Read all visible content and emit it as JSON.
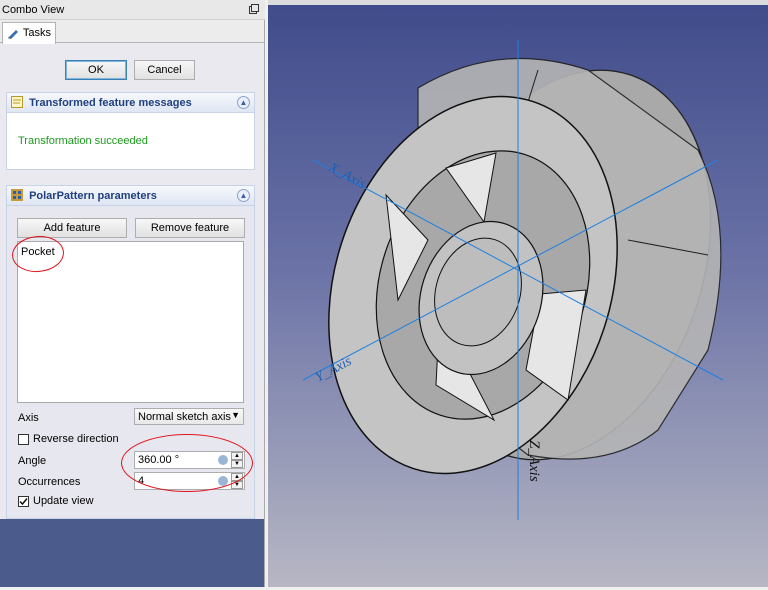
{
  "combo_view": {
    "title": "Combo View",
    "tab_label": "Tasks"
  },
  "dialog": {
    "ok_label": "OK",
    "cancel_label": "Cancel"
  },
  "messages_box": {
    "title": "Transformed feature messages",
    "text": "Transformation succeeded"
  },
  "polar_box": {
    "title": "PolarPattern parameters",
    "add_feature_label": "Add feature",
    "remove_feature_label": "Remove feature",
    "features": [
      "Pocket"
    ],
    "axis_label": "Axis",
    "axis_value": "Normal sketch axis",
    "reverse_label": "Reverse direction",
    "reverse_checked": false,
    "angle_label": "Angle",
    "angle_value": "360.00 °",
    "occurrences_label": "Occurrences",
    "occurrences_value": "4",
    "update_label": "Update view",
    "update_checked": true
  },
  "viewport": {
    "axis_labels": {
      "x": "X_Axis",
      "y": "Y_Axis",
      "z": "Z_Axis"
    }
  },
  "colors": {
    "success_text": "#1e9a1e",
    "annotation_red": "#e0141e",
    "axis_blue": "#1f7fe0",
    "bg_top": "#3f4b8a"
  }
}
